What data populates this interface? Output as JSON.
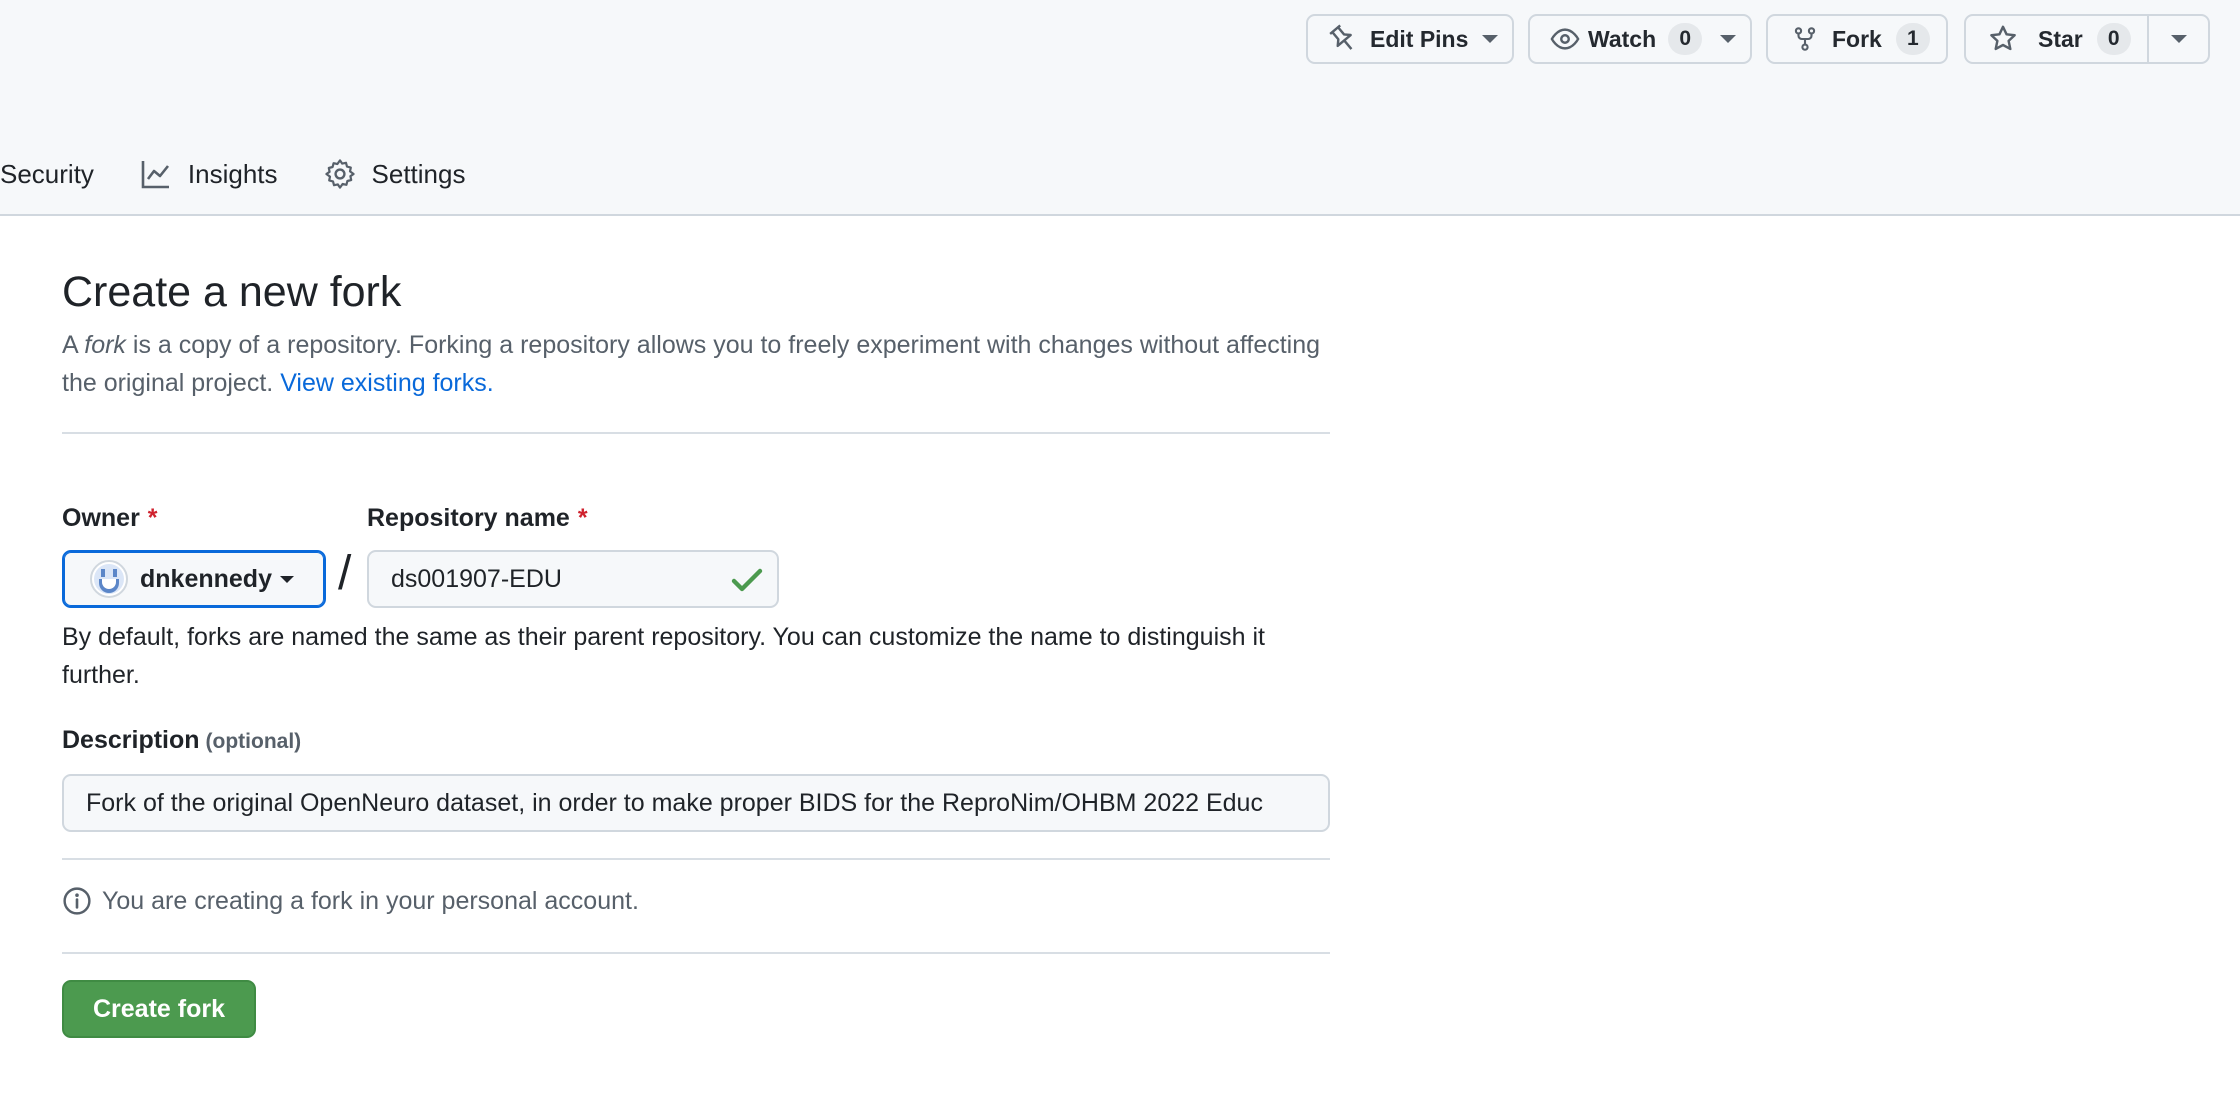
{
  "repo_actions": {
    "edit_pins_label": "Edit Pins",
    "watch_label": "Watch",
    "watch_count": "0",
    "fork_label": "Fork",
    "fork_count": "1",
    "star_label": "Star",
    "star_count": "0"
  },
  "repo_nav": {
    "tabs": [
      {
        "label": "Security"
      },
      {
        "label": "Insights",
        "icon": "graph-icon"
      },
      {
        "label": "Settings",
        "icon": "gear-icon"
      }
    ]
  },
  "fork_form": {
    "title": "Create a new fork",
    "description_prefix": "A ",
    "description_em": "fork",
    "description_rest": " is a copy of a repository. Forking a repository allows you to freely experiment with changes without affecting the original project. ",
    "view_forks_link": "View existing forks.",
    "owner_label": "Owner",
    "required_marker": "*",
    "owner_value": "dnkennedy",
    "repo_name_label": "Repository name",
    "repo_name_value": "ds001907-EDU",
    "slash": "/",
    "name_hint": "By default, forks are named the same as their parent repository. You can customize the name to distinguish it further.",
    "description_label": "Description",
    "description_optional": "(optional)",
    "description_value": "Fork of the original OpenNeuro dataset, in order to make proper BIDS for the ReproNim/OHBM 2022 Educ",
    "info_text": "You are creating a fork in your personal account.",
    "create_button_label": "Create fork"
  },
  "colors": {
    "link": "#0969da",
    "required": "#cf222e",
    "primary_button": "#4c9a4f",
    "valid_check": "#4c9a4f"
  }
}
